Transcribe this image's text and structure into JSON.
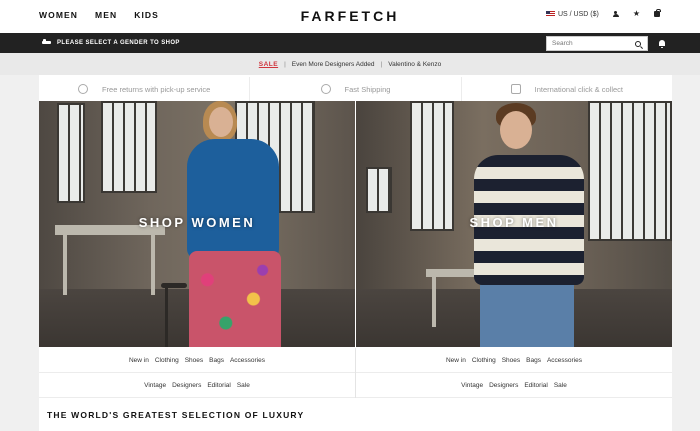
{
  "header": {
    "nav": [
      "WOMEN",
      "MEN",
      "KIDS"
    ],
    "logo": "FARFETCH",
    "currency": "US / USD ($)"
  },
  "gender_bar": {
    "prompt": "PLEASE SELECT A GENDER TO SHOP",
    "search_placeholder": "Search"
  },
  "promo": {
    "sale": "SALE",
    "item1": "Even More Designers Added",
    "item2": "Valentino & Kenzo",
    "sep": "|"
  },
  "usp": [
    {
      "label": "Free returns with pick-up service",
      "icon": "returns-icon"
    },
    {
      "label": "Fast Shipping",
      "icon": "shipping-icon"
    },
    {
      "label": "International click & collect",
      "icon": "collect-icon"
    }
  ],
  "women": {
    "label": "SHOP WOMEN",
    "row1": [
      "New in",
      "Clothing",
      "Shoes",
      "Bags",
      "Accessories"
    ],
    "row2": [
      "Vintage",
      "Designers",
      "Editorial",
      "Sale"
    ]
  },
  "men": {
    "label": "SHOP MEN",
    "row1": [
      "New in",
      "Clothing",
      "Shoes",
      "Bags",
      "Accessories"
    ],
    "row2": [
      "Vintage",
      "Designers",
      "Editorial",
      "Sale"
    ]
  },
  "section_title": "THE WORLD'S GREATEST SELECTION OF LUXURY"
}
